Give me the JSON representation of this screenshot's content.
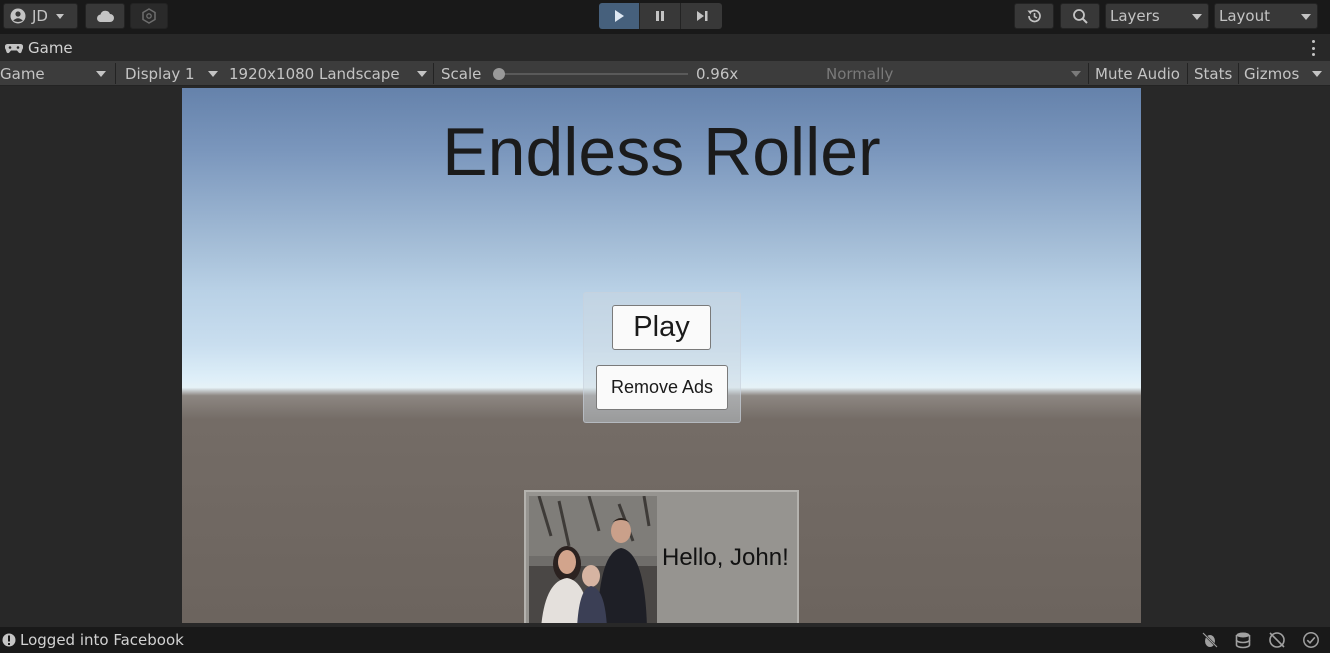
{
  "toolbar": {
    "account": "JD",
    "layers": "Layers",
    "layout": "Layout",
    "play_state": "playing"
  },
  "tab": {
    "title": "Game"
  },
  "options": {
    "view": "Game",
    "display": "Display 1",
    "resolution": "1920x1080 Landscape",
    "scale_label": "Scale",
    "scale_value": "0.96x",
    "scale_level": 0.0,
    "play_mode": "Normally",
    "mute_audio": "Mute Audio",
    "stats": "Stats",
    "gizmos": "Gizmos"
  },
  "game": {
    "title": "Endless Roller",
    "play_label": "Play",
    "remove_ads_label": "Remove Ads",
    "greeting": "Hello, John!"
  },
  "status": {
    "message": "Logged into Facebook"
  }
}
